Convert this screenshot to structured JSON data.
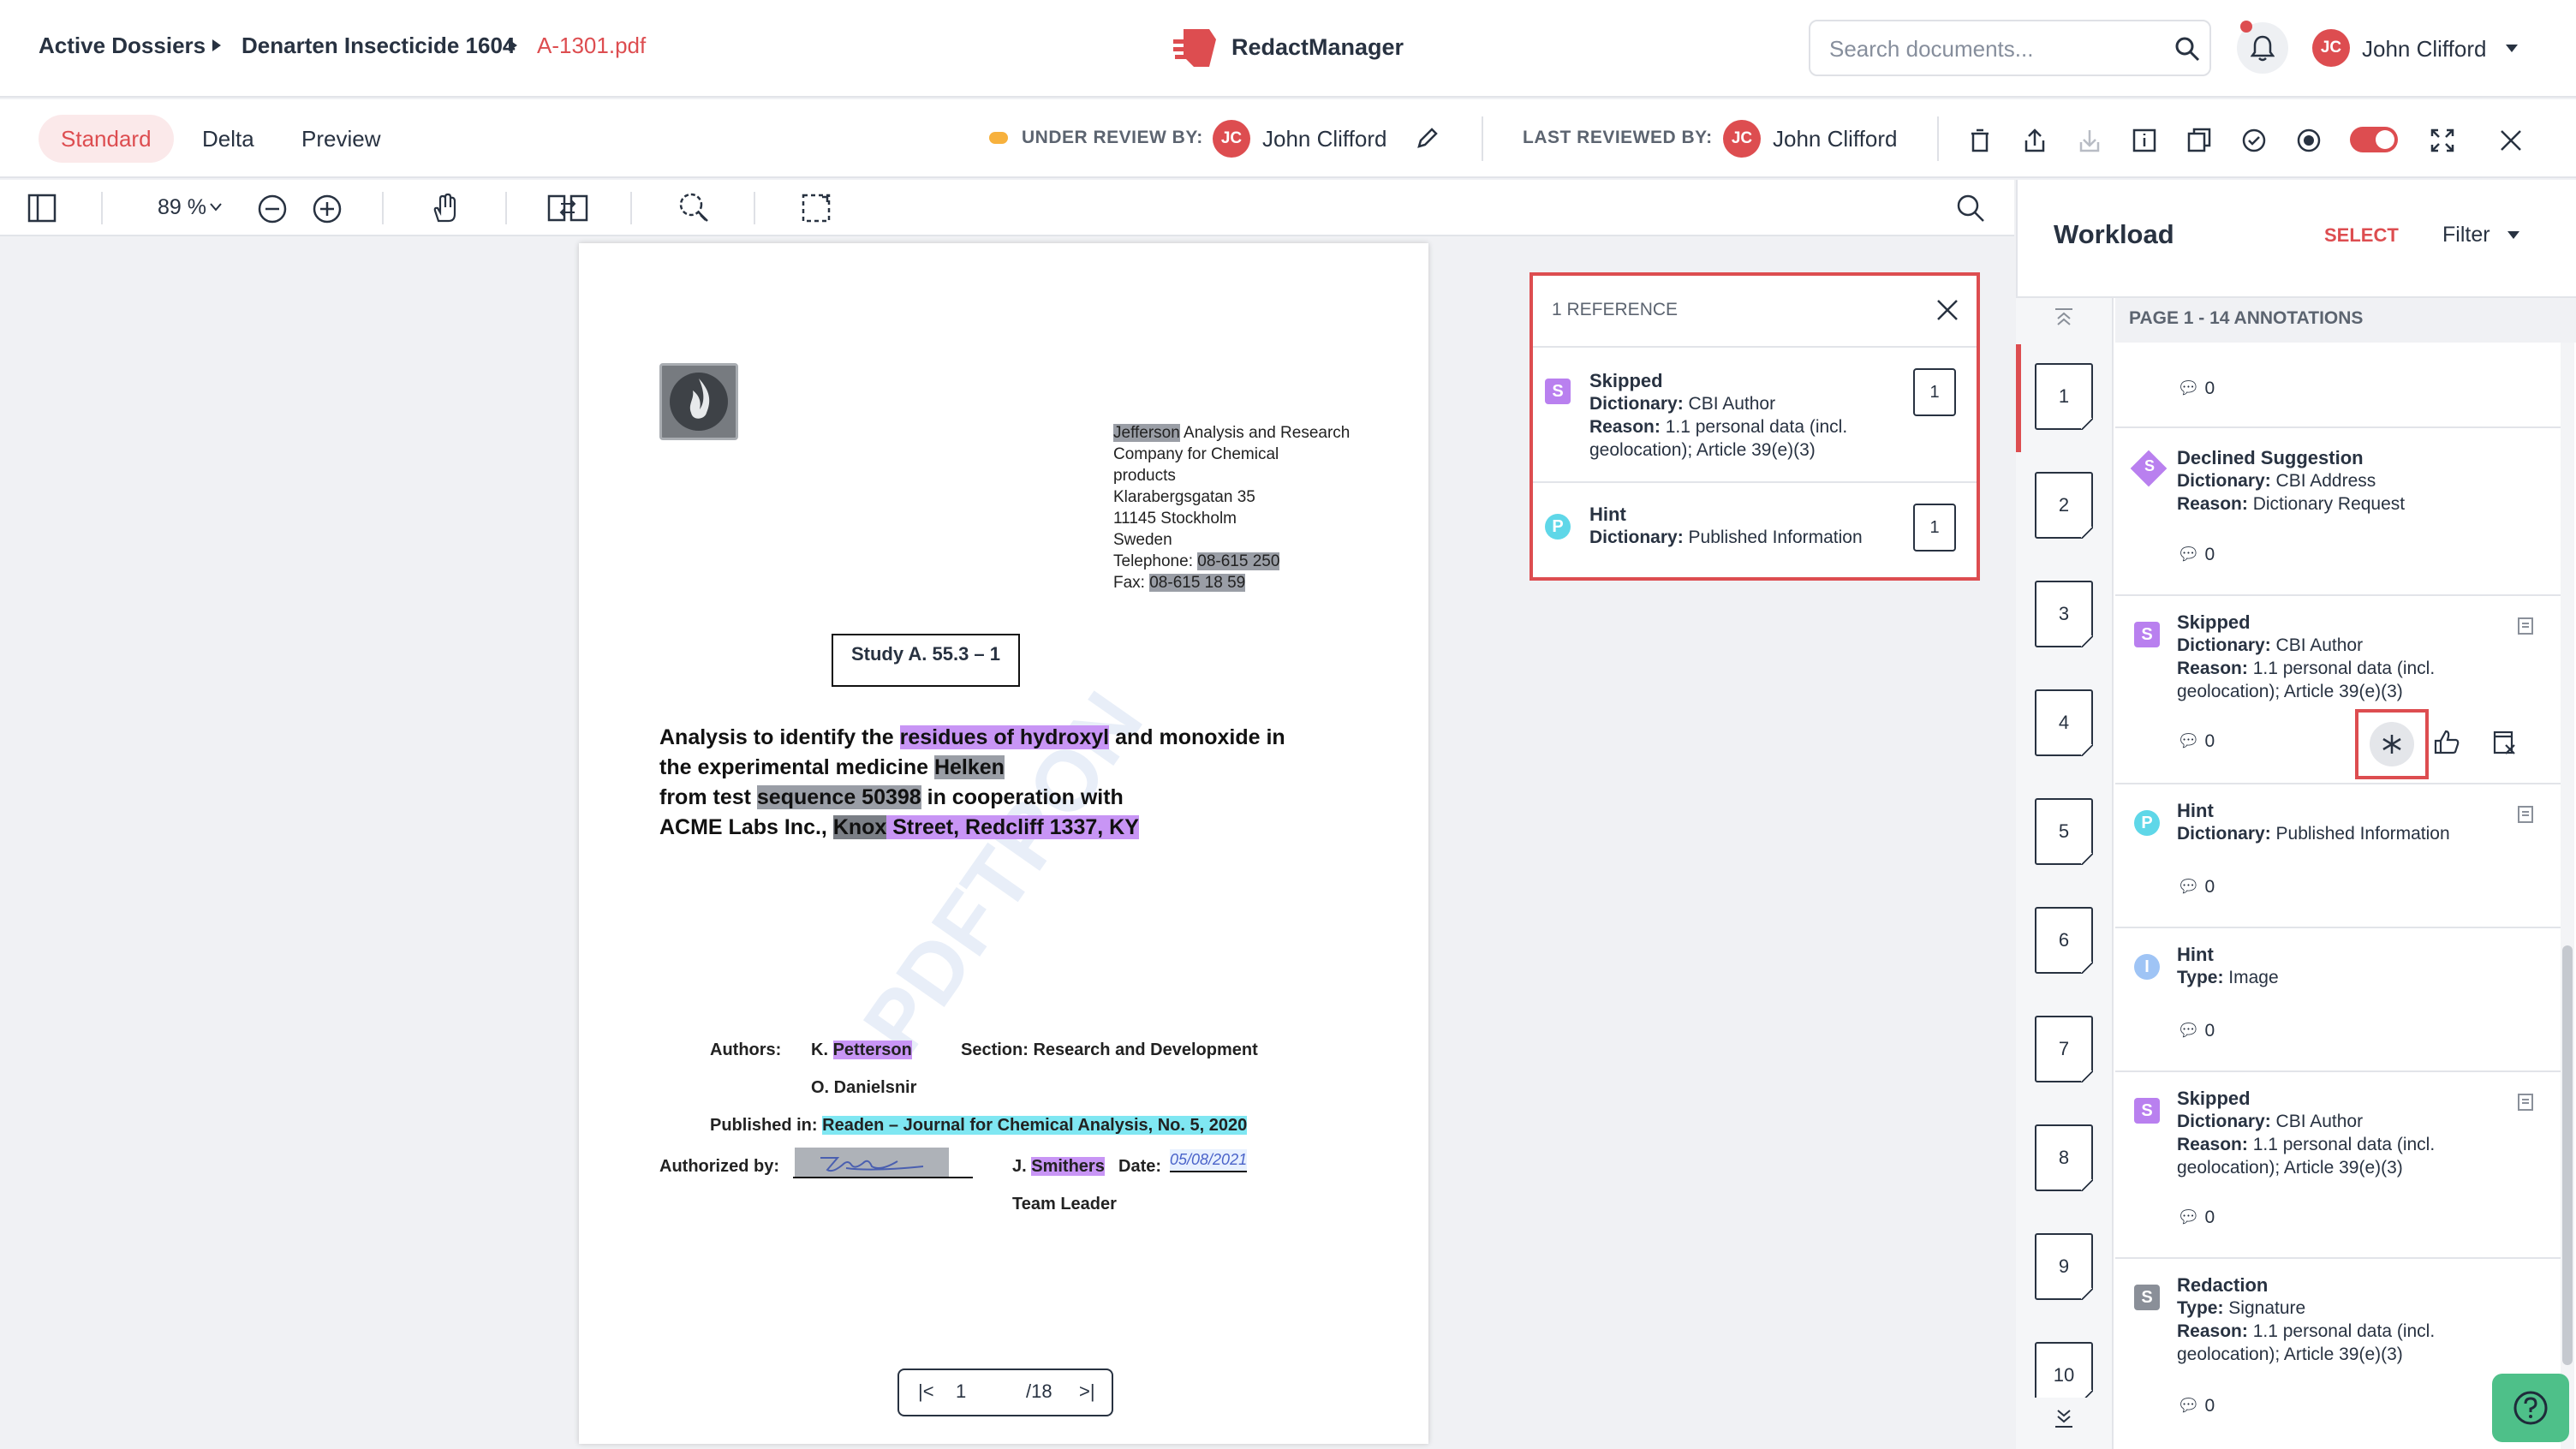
{
  "header": {
    "breadcrumbs": [
      "Active Dossiers",
      "Denarten Insecticide 1604",
      "A-1301.pdf"
    ],
    "app_name": "RedactManager",
    "search_placeholder": "Search documents...",
    "user": {
      "initials": "JC",
      "name": "John Clifford"
    }
  },
  "colors": {
    "accent": "#dd4d50",
    "skipped": "#b980ef",
    "hint": "#5fd7e8",
    "hint_image": "#9fc4f5",
    "redaction": "#8a8f98"
  },
  "secondary_bar": {
    "tabs": [
      "Standard",
      "Delta",
      "Preview"
    ],
    "active_tab": "Standard",
    "under_review_label": "UNDER REVIEW BY:",
    "under_review_name": "John Clifford",
    "last_reviewed_label": "LAST REVIEWED BY:",
    "last_reviewed_name": "John Clifford",
    "toggle_on": true
  },
  "toolbar": {
    "zoom": "89 %"
  },
  "document": {
    "address_lines": [
      "Jefferson",
      " Analysis and Research",
      "Company for Chemical",
      "products",
      "Klarabergsgatan 35",
      "11145 Stockholm",
      "Sweden",
      "Telephone: ",
      "08-615 250",
      "Fax: ",
      "08-615 18 59"
    ],
    "study_title": "Study A. 55.3 – 1",
    "body": {
      "l1a": "Analysis to identify the ",
      "l1b": "residues of hydroxyl",
      "l1c": " and monoxide in",
      "l2a": "the experimental medicine ",
      "l2b": "Helken",
      "l3a": "from test ",
      "l3b": "sequence 50398",
      "l3c": " in cooperation with",
      "l4a": "ACME Labs Inc., ",
      "l4b": "Knox",
      "l4c": " Street, Redcliff 1337, KY"
    },
    "authors_label": "Authors:",
    "author1_prefix": "K. ",
    "author1_name": "Petterson",
    "author2": "O. Danielsnir",
    "section": "Section: Research and Development",
    "published_label": "Published in: ",
    "published_value": "Readen – Journal for Chemical Analysis, No. 5, 2020",
    "authorized_label": "Authorized by:",
    "signer_prefix": "J. ",
    "signer_name": "Smithers",
    "date_label": "Date:",
    "date_value": "05/08/2021",
    "team_leader": "Team Leader",
    "watermark": "PDFTRON",
    "pager": {
      "current": "1",
      "total": "/18"
    }
  },
  "reference_popup": {
    "title": "1 REFERENCE",
    "items": [
      {
        "icon": "S",
        "title": "Skipped",
        "dict_label": "Dictionary:",
        "dict_value": "CBI Author",
        "reason_label": "Reason:",
        "reason_value": "1.1 personal data (incl. geolocation); Article 39(e)(3)",
        "page": "1"
      },
      {
        "icon": "P",
        "title": "Hint",
        "dict_label": "Dictionary:",
        "dict_value": "Published Information",
        "page": "1"
      }
    ]
  },
  "workload": {
    "title": "Workload",
    "select": "SELECT",
    "filter": "Filter",
    "page_header": "PAGE 1 - 14 ANNOTATIONS",
    "pages": [
      "1",
      "2",
      "3",
      "4",
      "5",
      "6",
      "7",
      "8",
      "9",
      "10"
    ],
    "annotations": [
      {
        "comments": "0"
      },
      {
        "icon": "S",
        "title": "Declined Suggestion",
        "l1_label": "Dictionary:",
        "l1_value": "CBI Address",
        "l2_label": "Reason:",
        "l2_value": "Dictionary Request",
        "comments": "0"
      },
      {
        "icon": "S",
        "title": "Skipped",
        "l1_label": "Dictionary:",
        "l1_value": "CBI Author",
        "l2_label": "Reason:",
        "l2_value": "1.1 personal data (incl. geolocation); Article 39(e)(3)",
        "comments": "0"
      },
      {
        "icon": "P",
        "title": "Hint",
        "l1_label": "Dictionary:",
        "l1_value": "Published Information",
        "comments": "0"
      },
      {
        "icon": "I",
        "title": "Hint",
        "l1_label": "Type:",
        "l1_value": "Image",
        "comments": "0"
      },
      {
        "icon": "S",
        "title": "Skipped",
        "l1_label": "Dictionary:",
        "l1_value": "CBI Author",
        "l2_label": "Reason:",
        "l2_value": "1.1 personal data (incl. geolocation); Article 39(e)(3)",
        "comments": "0"
      },
      {
        "icon": "S",
        "title": "Redaction",
        "l1_label": "Type:",
        "l1_value": "Signature",
        "l2_label": "Reason:",
        "l2_value": "1.1 personal data (incl. geolocation); Article 39(e)(3)",
        "comments": "0"
      }
    ]
  }
}
